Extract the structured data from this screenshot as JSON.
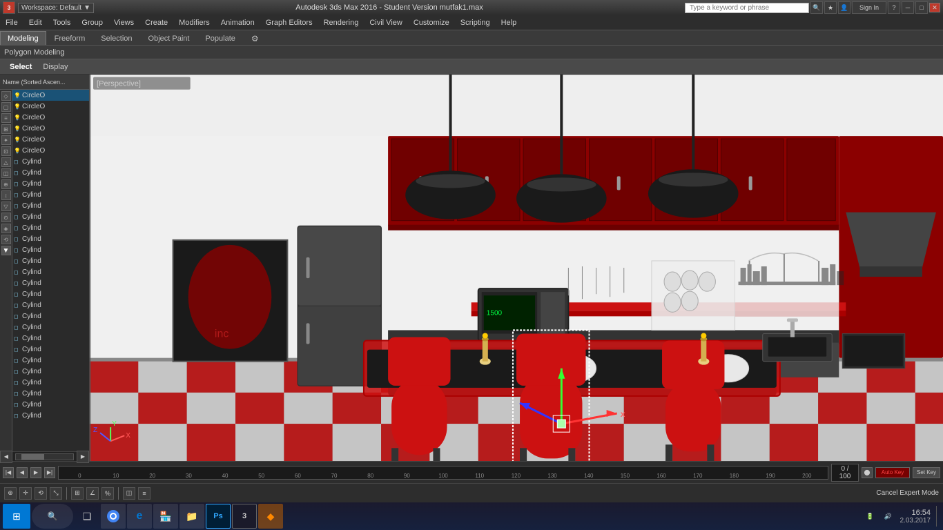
{
  "titleBar": {
    "appTitle": "Autodesk 3ds Max 2016 - Student Version    mutfak1.max",
    "workspace": "Workspace: Default",
    "searchPlaceholder": "Type a keyword or phrase",
    "signIn": "Sign In",
    "buttons": {
      "minimize": "─",
      "maximize": "□",
      "close": "✕",
      "restore": "❐"
    }
  },
  "menuBar": {
    "items": [
      {
        "id": "file",
        "label": "File"
      },
      {
        "id": "edit",
        "label": "Edit"
      },
      {
        "id": "tools",
        "label": "Tools"
      },
      {
        "id": "group",
        "label": "Group"
      },
      {
        "id": "views",
        "label": "Views"
      },
      {
        "id": "create",
        "label": "Create"
      },
      {
        "id": "modifiers",
        "label": "Modifiers"
      },
      {
        "id": "animation",
        "label": "Animation"
      },
      {
        "id": "graphEditors",
        "label": "Graph Editors"
      },
      {
        "id": "rendering",
        "label": "Rendering"
      },
      {
        "id": "civilView",
        "label": "Civil View"
      },
      {
        "id": "customize",
        "label": "Customize"
      },
      {
        "id": "scripting",
        "label": "Scripting"
      },
      {
        "id": "help",
        "label": "Help"
      }
    ]
  },
  "ribbonTabs": [
    {
      "id": "modeling",
      "label": "Modeling",
      "active": true
    },
    {
      "id": "freeform",
      "label": "Freeform"
    },
    {
      "id": "selection",
      "label": "Selection"
    },
    {
      "id": "objectPaint",
      "label": "Object Paint"
    },
    {
      "id": "populate",
      "label": "Populate"
    },
    {
      "id": "settings",
      "label": "⚙"
    }
  ],
  "polyModelingLabel": "Polygon Modeling",
  "subTabs": [
    {
      "id": "select",
      "label": "Select",
      "active": true
    },
    {
      "id": "display",
      "label": "Display"
    }
  ],
  "sceneExplorer": {
    "header": "Name (Sorted Ascen...",
    "items": [
      {
        "id": 1,
        "name": "CircleO",
        "type": "circle",
        "icon": "bulb"
      },
      {
        "id": 2,
        "name": "CircleO",
        "type": "circle",
        "icon": "bulb"
      },
      {
        "id": 3,
        "name": "CircleO",
        "type": "circle",
        "icon": "bulb"
      },
      {
        "id": 4,
        "name": "CircleO",
        "type": "circle",
        "icon": "bulb"
      },
      {
        "id": 5,
        "name": "CircleO",
        "type": "circle",
        "icon": "bulb"
      },
      {
        "id": 6,
        "name": "CircleO",
        "type": "circle",
        "icon": "bulb"
      },
      {
        "id": 7,
        "name": "Cylind",
        "type": "cylinder",
        "icon": "box"
      },
      {
        "id": 8,
        "name": "Cylind",
        "type": "cylinder",
        "icon": "box"
      },
      {
        "id": 9,
        "name": "Cylind",
        "type": "cylinder",
        "icon": "box"
      },
      {
        "id": 10,
        "name": "Cylind",
        "type": "cylinder",
        "icon": "box"
      },
      {
        "id": 11,
        "name": "Cylind",
        "type": "cylinder",
        "icon": "box"
      },
      {
        "id": 12,
        "name": "Cylind",
        "type": "cylinder",
        "icon": "box"
      },
      {
        "id": 13,
        "name": "Cylind",
        "type": "cylinder",
        "icon": "box"
      },
      {
        "id": 14,
        "name": "Cylind",
        "type": "cylinder",
        "icon": "box"
      },
      {
        "id": 15,
        "name": "Cylind",
        "type": "cylinder",
        "icon": "box"
      },
      {
        "id": 16,
        "name": "Cylind",
        "type": "cylinder",
        "icon": "box"
      },
      {
        "id": 17,
        "name": "Cylind",
        "type": "cylinder",
        "icon": "box"
      },
      {
        "id": 18,
        "name": "Cylind",
        "type": "cylinder",
        "icon": "box"
      },
      {
        "id": 19,
        "name": "Cylind",
        "type": "cylinder",
        "icon": "box"
      },
      {
        "id": 20,
        "name": "Cylind",
        "type": "cylinder",
        "icon": "box"
      },
      {
        "id": 21,
        "name": "Cylind",
        "type": "cylinder",
        "icon": "box"
      },
      {
        "id": 22,
        "name": "Cylind",
        "type": "cylinder",
        "icon": "box"
      },
      {
        "id": 23,
        "name": "Cylind",
        "type": "cylinder",
        "icon": "box"
      },
      {
        "id": 24,
        "name": "Cylind",
        "type": "cylinder",
        "icon": "box"
      },
      {
        "id": 25,
        "name": "Cylind",
        "type": "cylinder",
        "icon": "box"
      },
      {
        "id": 26,
        "name": "Cylind",
        "type": "cylinder",
        "icon": "box"
      },
      {
        "id": 27,
        "name": "Cylind",
        "type": "cylinder",
        "icon": "box"
      },
      {
        "id": 28,
        "name": "Cylind",
        "type": "cylinder",
        "icon": "box"
      },
      {
        "id": 29,
        "name": "Cylind",
        "type": "cylinder",
        "icon": "box"
      },
      {
        "id": 30,
        "name": "Cylind",
        "type": "cylinder",
        "icon": "box"
      }
    ]
  },
  "viewport": {
    "label": "Perspective",
    "backgroundColor": "#1a1a1a"
  },
  "timeline": {
    "frameLabel": "0 / 100",
    "ticks": [
      "0",
      "10",
      "20",
      "30",
      "40",
      "50",
      "60",
      "70",
      "80",
      "90",
      "100",
      "110",
      "120",
      "130",
      "140",
      "150",
      "160",
      "170",
      "180",
      "190",
      "200"
    ]
  },
  "statusBar": {
    "cancelExpertMode": "Cancel Expert Mode"
  },
  "taskbar": {
    "time": "16:54",
    "date": "2.03.2017",
    "apps": [
      {
        "id": "start",
        "label": "⊞"
      },
      {
        "id": "search",
        "label": "🔍"
      },
      {
        "id": "taskview",
        "label": "❑"
      },
      {
        "id": "chrome",
        "label": "●"
      },
      {
        "id": "edge",
        "label": "e"
      },
      {
        "id": "store",
        "label": "🏪"
      },
      {
        "id": "explorer",
        "label": "📁"
      },
      {
        "id": "photoshop",
        "label": "Ps"
      },
      {
        "id": "3dsmax",
        "label": "3"
      },
      {
        "id": "unknown",
        "label": "◆"
      }
    ]
  }
}
